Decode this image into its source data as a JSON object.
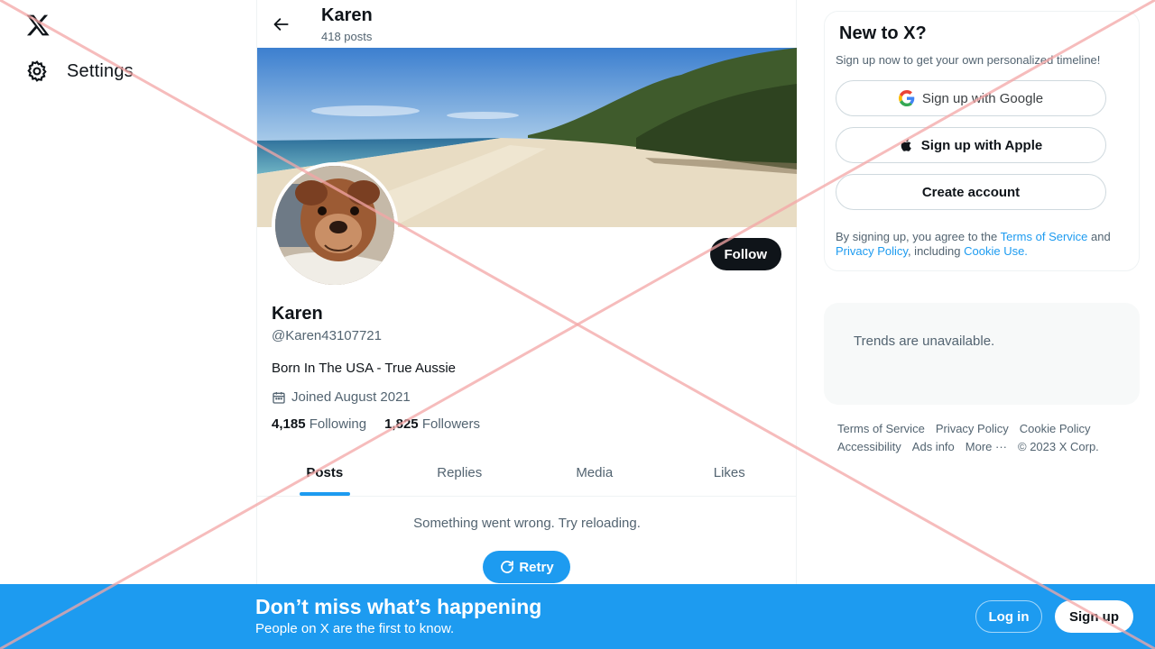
{
  "nav": {
    "logo_icon": "x-logo-icon",
    "settings_label": "Settings",
    "settings_icon": "gear-icon"
  },
  "header": {
    "name": "Karen",
    "post_count": "418 posts",
    "back_icon": "arrow-left-icon"
  },
  "profile": {
    "name": "Karen",
    "handle": "@Karen43107721",
    "bio": "Born In The USA - True Aussie",
    "joined": "Joined August 2021",
    "joined_icon": "calendar-icon",
    "following_count": "4,185",
    "following_label": "Following",
    "followers_count": "1,825",
    "followers_label": "Followers",
    "follow_label": "Follow"
  },
  "tabs": [
    {
      "label": "Posts",
      "active": true
    },
    {
      "label": "Replies",
      "active": false
    },
    {
      "label": "Media",
      "active": false
    },
    {
      "label": "Likes",
      "active": false
    }
  ],
  "feed": {
    "error": "Something went wrong. Try reloading.",
    "retry_label": "Retry",
    "retry_icon": "refresh-icon"
  },
  "signup_card": {
    "title": "New to X?",
    "subtitle": "Sign up now to get your own personalized timeline!",
    "google_label": "Sign up with Google",
    "apple_label": "Sign up with Apple",
    "create_label": "Create account",
    "terms_prefix": "By signing up, you agree to the ",
    "terms_link": "Terms of Service",
    "terms_and": " and ",
    "privacy_link": "Privacy Policy",
    "terms_including": ", including ",
    "cookie_link": "Cookie Use."
  },
  "trends": {
    "message": "Trends are unavailable."
  },
  "footer": {
    "links": [
      "Terms of Service",
      "Privacy Policy",
      "Cookie Policy",
      "Accessibility",
      "Ads info",
      "More ···"
    ],
    "copyright": "© 2023 X Corp."
  },
  "bottom_bar": {
    "headline": "Don’t miss what’s happening",
    "subline": "People on X are the first to know.",
    "login_label": "Log in",
    "signup_label": "Sign up"
  },
  "colors": {
    "accent": "#1d9bf0",
    "text_primary": "#0f1419",
    "text_secondary": "#536471",
    "overlay_cross": "#f4a6a6"
  }
}
